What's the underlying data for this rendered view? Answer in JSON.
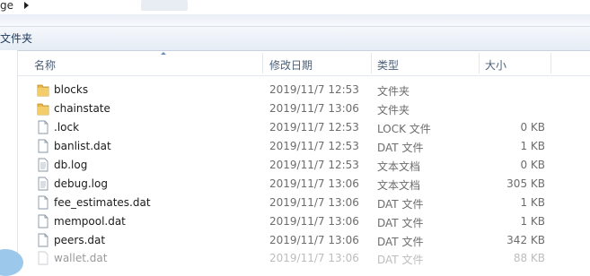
{
  "address": {
    "crumb": "ge"
  },
  "toolbar": {
    "label": "文件夹"
  },
  "columns": {
    "name": "名称",
    "date": "修改日期",
    "type": "类型",
    "size": "大小"
  },
  "files": [
    {
      "name": "blocks",
      "date": "2019/11/7 12:53",
      "type": "文件夹",
      "size": "",
      "icon": "folder-icon"
    },
    {
      "name": "chainstate",
      "date": "2019/11/7 13:06",
      "type": "文件夹",
      "size": "",
      "icon": "folder-icon"
    },
    {
      "name": ".lock",
      "date": "2019/11/7 12:53",
      "type": "LOCK 文件",
      "size": "0 KB",
      "icon": "file-icon"
    },
    {
      "name": "banlist.dat",
      "date": "2019/11/7 12:53",
      "type": "DAT 文件",
      "size": "1 KB",
      "icon": "file-icon"
    },
    {
      "name": "db.log",
      "date": "2019/11/7 12:53",
      "type": "文本文档",
      "size": "0 KB",
      "icon": "text-file-icon"
    },
    {
      "name": "debug.log",
      "date": "2019/11/7 13:06",
      "type": "文本文档",
      "size": "305 KB",
      "icon": "text-file-icon"
    },
    {
      "name": "fee_estimates.dat",
      "date": "2019/11/7 13:06",
      "type": "DAT 文件",
      "size": "1 KB",
      "icon": "file-icon"
    },
    {
      "name": "mempool.dat",
      "date": "2019/11/7 13:06",
      "type": "DAT 文件",
      "size": "1 KB",
      "icon": "file-icon"
    },
    {
      "name": "peers.dat",
      "date": "2019/11/7 13:06",
      "type": "DAT 文件",
      "size": "342 KB",
      "icon": "file-icon"
    },
    {
      "name": "wallet.dat",
      "date": "2019/11/7 13:06",
      "type": "DAT 文件",
      "size": "88 KB",
      "icon": "file-icon"
    }
  ],
  "colors": {
    "accent": "#4c607a",
    "toolbar_text": "#1e395b",
    "folder": "#e8b84a"
  }
}
